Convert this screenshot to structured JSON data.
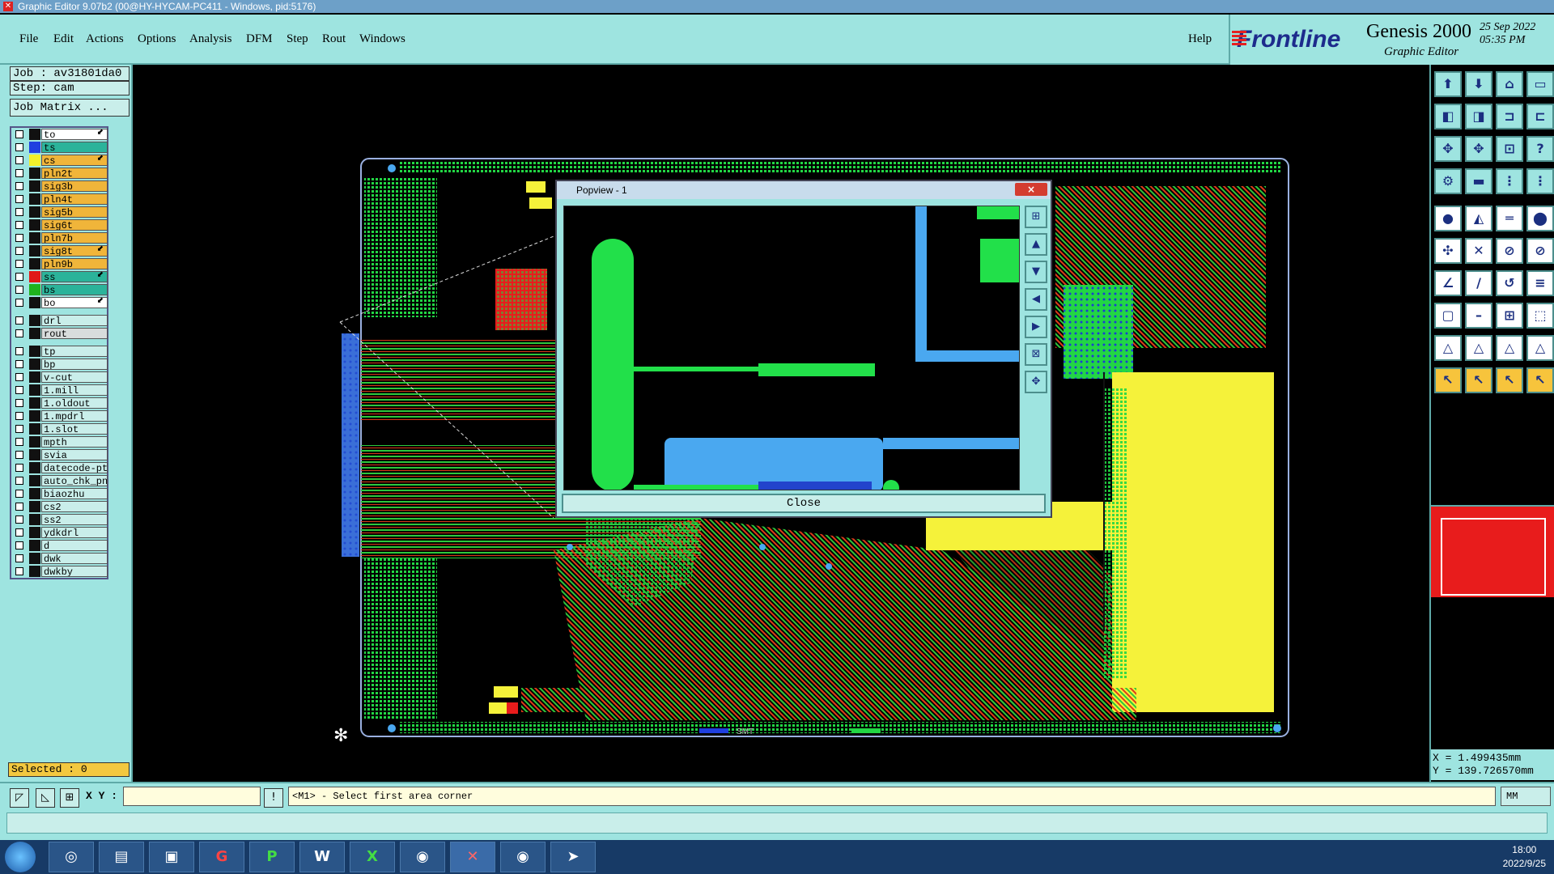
{
  "window": {
    "title": "Graphic Editor 9.07b2 (00@HY-HYCAM-PC411 - Windows, pid:5176)"
  },
  "menu": {
    "items": [
      "File",
      "Edit",
      "Actions",
      "Options",
      "Analysis",
      "DFM",
      "Step",
      "Rout",
      "Windows"
    ],
    "help": "Help"
  },
  "brand": {
    "logo": "Frontline",
    "product": "Genesis 2000",
    "subtitle": "Graphic Editor",
    "date": "25 Sep 2022",
    "time": "05:35 PM"
  },
  "job": {
    "job_label": "Job : av31801da0",
    "step_label": "Step: cam",
    "matrix_button": "Job Matrix ..."
  },
  "layers": {
    "group1": [
      {
        "name": "to",
        "swatch": "#111111",
        "bg": "#ffffff",
        "arrow": true
      },
      {
        "name": "ts",
        "swatch": "#1f3fe0",
        "bg": "#2bb39a",
        "arrow": false
      },
      {
        "name": "cs",
        "swatch": "#f1f02a",
        "bg": "#f0b53a",
        "arrow": true
      },
      {
        "name": "pln2t",
        "swatch": "#111111",
        "bg": "#f0b53a",
        "arrow": false
      },
      {
        "name": "sig3b",
        "swatch": "#111111",
        "bg": "#f0b53a",
        "arrow": false
      },
      {
        "name": "pln4t",
        "swatch": "#111111",
        "bg": "#f0b53a",
        "arrow": false
      },
      {
        "name": "sig5b",
        "swatch": "#111111",
        "bg": "#f0b53a",
        "arrow": false
      },
      {
        "name": "sig6t",
        "swatch": "#111111",
        "bg": "#f0b53a",
        "arrow": false
      },
      {
        "name": "pln7b",
        "swatch": "#111111",
        "bg": "#f0b53a",
        "arrow": false
      },
      {
        "name": "sig8t",
        "swatch": "#111111",
        "bg": "#f0b53a",
        "arrow": true
      },
      {
        "name": "pln9b",
        "swatch": "#111111",
        "bg": "#f0b53a",
        "arrow": false
      },
      {
        "name": "ss",
        "swatch": "#e01818",
        "bg": "#2bb39a",
        "arrow": true
      },
      {
        "name": "bs",
        "swatch": "#1eb31e",
        "bg": "#2bb39a",
        "arrow": false
      },
      {
        "name": "bo",
        "swatch": "#111111",
        "bg": "#ffffff",
        "arrow": true
      }
    ],
    "group2": [
      {
        "name": "drl",
        "swatch": "#111111",
        "bg": "#c9eeea",
        "arrow": false
      },
      {
        "name": "rout",
        "swatch": "#111111",
        "bg": "#d8dcdc",
        "arrow": false
      }
    ],
    "group3": [
      {
        "name": "tp",
        "swatch": "#111111",
        "bg": "#c9eeea",
        "arrow": false
      },
      {
        "name": "bp",
        "swatch": "#111111",
        "bg": "#c9eeea",
        "arrow": false
      },
      {
        "name": "v-cut",
        "swatch": "#111111",
        "bg": "#c9eeea",
        "arrow": false
      },
      {
        "name": "1.mill",
        "swatch": "#111111",
        "bg": "#c9eeea",
        "arrow": false
      },
      {
        "name": "1.oldout",
        "swatch": "#111111",
        "bg": "#c9eeea",
        "arrow": false
      },
      {
        "name": "1.mpdrl",
        "swatch": "#111111",
        "bg": "#c9eeea",
        "arrow": false
      },
      {
        "name": "1.slot",
        "swatch": "#111111",
        "bg": "#c9eeea",
        "arrow": false
      },
      {
        "name": "mpth",
        "swatch": "#111111",
        "bg": "#c9eeea",
        "arrow": false
      },
      {
        "name": "svia",
        "swatch": "#111111",
        "bg": "#c9eeea",
        "arrow": false
      },
      {
        "name": "datecode-pt",
        "swatch": "#111111",
        "bg": "#c9eeea",
        "arrow": false
      },
      {
        "name": "auto_chk_pn",
        "swatch": "#111111",
        "bg": "#c9eeea",
        "arrow": false
      },
      {
        "name": "biaozhu",
        "swatch": "#111111",
        "bg": "#c9eeea",
        "arrow": false
      },
      {
        "name": "cs2",
        "swatch": "#111111",
        "bg": "#c9eeea",
        "arrow": false
      },
      {
        "name": "ss2",
        "swatch": "#111111",
        "bg": "#c9eeea",
        "arrow": false
      },
      {
        "name": "ydkdrl",
        "swatch": "#111111",
        "bg": "#c9eeea",
        "arrow": false
      },
      {
        "name": "d",
        "swatch": "#111111",
        "bg": "#c9eeea",
        "arrow": false
      },
      {
        "name": "dwk",
        "swatch": "#111111",
        "bg": "#c9eeea",
        "arrow": false
      },
      {
        "name": "dwkby",
        "swatch": "#111111",
        "bg": "#c9eeea",
        "arrow": false
      }
    ]
  },
  "selected": "Selected : 0",
  "popview": {
    "title": "Popview - 1",
    "close_x": "×",
    "close_button": "Close"
  },
  "pcb_text": {
    "bottom_label": "SMT"
  },
  "coords": {
    "x": "X = 1.499435mm",
    "y": "Y = 139.726570mm"
  },
  "command": {
    "xy_label": "X Y :",
    "xy_value": "",
    "prompt": "<M1> - Select first area corner",
    "units": "MM"
  },
  "taskbar": {
    "time": "18:00",
    "date": "2022/9/25"
  },
  "colors": {
    "panel": "#9ee4e0",
    "canvas": "#000000",
    "trace_green": "#22d644",
    "trace_blue": "#4aa8f0"
  }
}
